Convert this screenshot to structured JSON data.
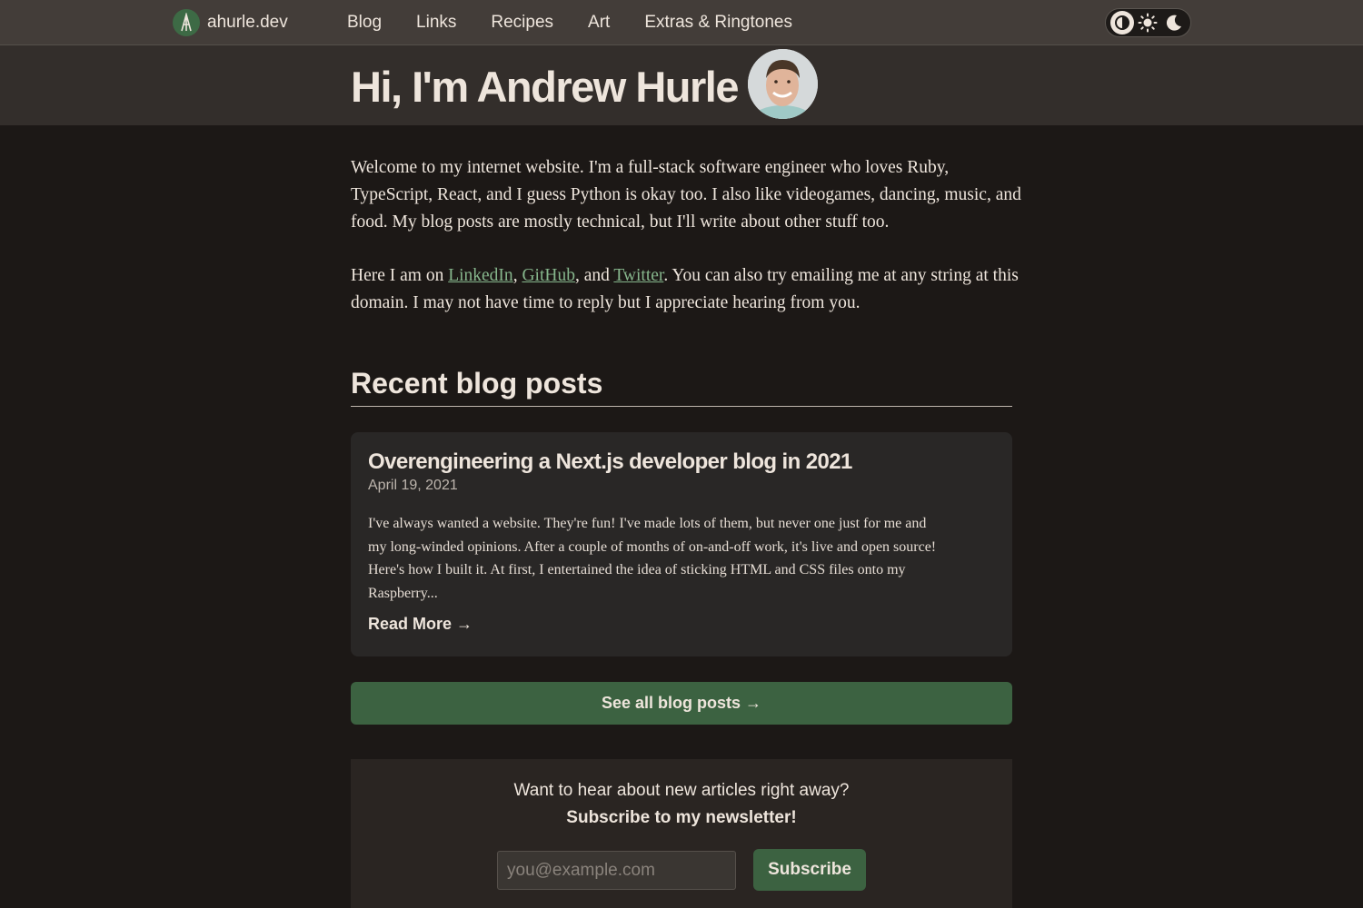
{
  "nav": {
    "brand": "ahurle.dev",
    "links": [
      "Blog",
      "Links",
      "Recipes",
      "Art",
      "Extras & Ringtones"
    ],
    "theme_options": [
      "system",
      "light",
      "dark"
    ],
    "theme_selected": "system"
  },
  "hero": {
    "title": "Hi, I'm Andrew Hurle"
  },
  "intro": {
    "paragraph1": "Welcome to my internet website. I'm a full-stack software engineer who loves Ruby, TypeScript, React, and I guess Python is okay too. I also like videogames, dancing, music, and food. My blog posts are mostly technical, but I'll write about other stuff too.",
    "p2_prefix": "Here I am on ",
    "link_linkedin": "LinkedIn",
    "sep1": ", ",
    "link_github": "GitHub",
    "sep2": ", and ",
    "link_twitter": "Twitter",
    "p2_suffix": ". You can also try emailing me at any string at this domain. I may not have time to reply but I appreciate hearing from you."
  },
  "recent": {
    "heading": "Recent blog posts",
    "posts": [
      {
        "title": "Overengineering a Next.js developer blog in 2021",
        "date": "April 19, 2021",
        "excerpt": "I've always wanted a website. They're fun! I've made lots of them, but never one just for me and my long-winded opinions. After a couple of months of on-and-off work, it's live and open source! Here's how I built it. At first, I entertained the idea of sticking HTML and CSS files onto my Raspberry...",
        "read_more": "Read More →"
      }
    ],
    "see_all": "See all blog posts →"
  },
  "newsletter": {
    "line1": "Want to hear about new articles right away?",
    "line2": "Subscribe to my newsletter!",
    "email_placeholder": "you@example.com",
    "email_value": "",
    "button": "Subscribe"
  },
  "colors": {
    "background": "#1c1816",
    "nav": "#433d39",
    "hero": "#332e2b",
    "card": "#292726",
    "accent_green": "#3c6241",
    "link_green": "#86b68c",
    "text": "#eee5dc"
  }
}
